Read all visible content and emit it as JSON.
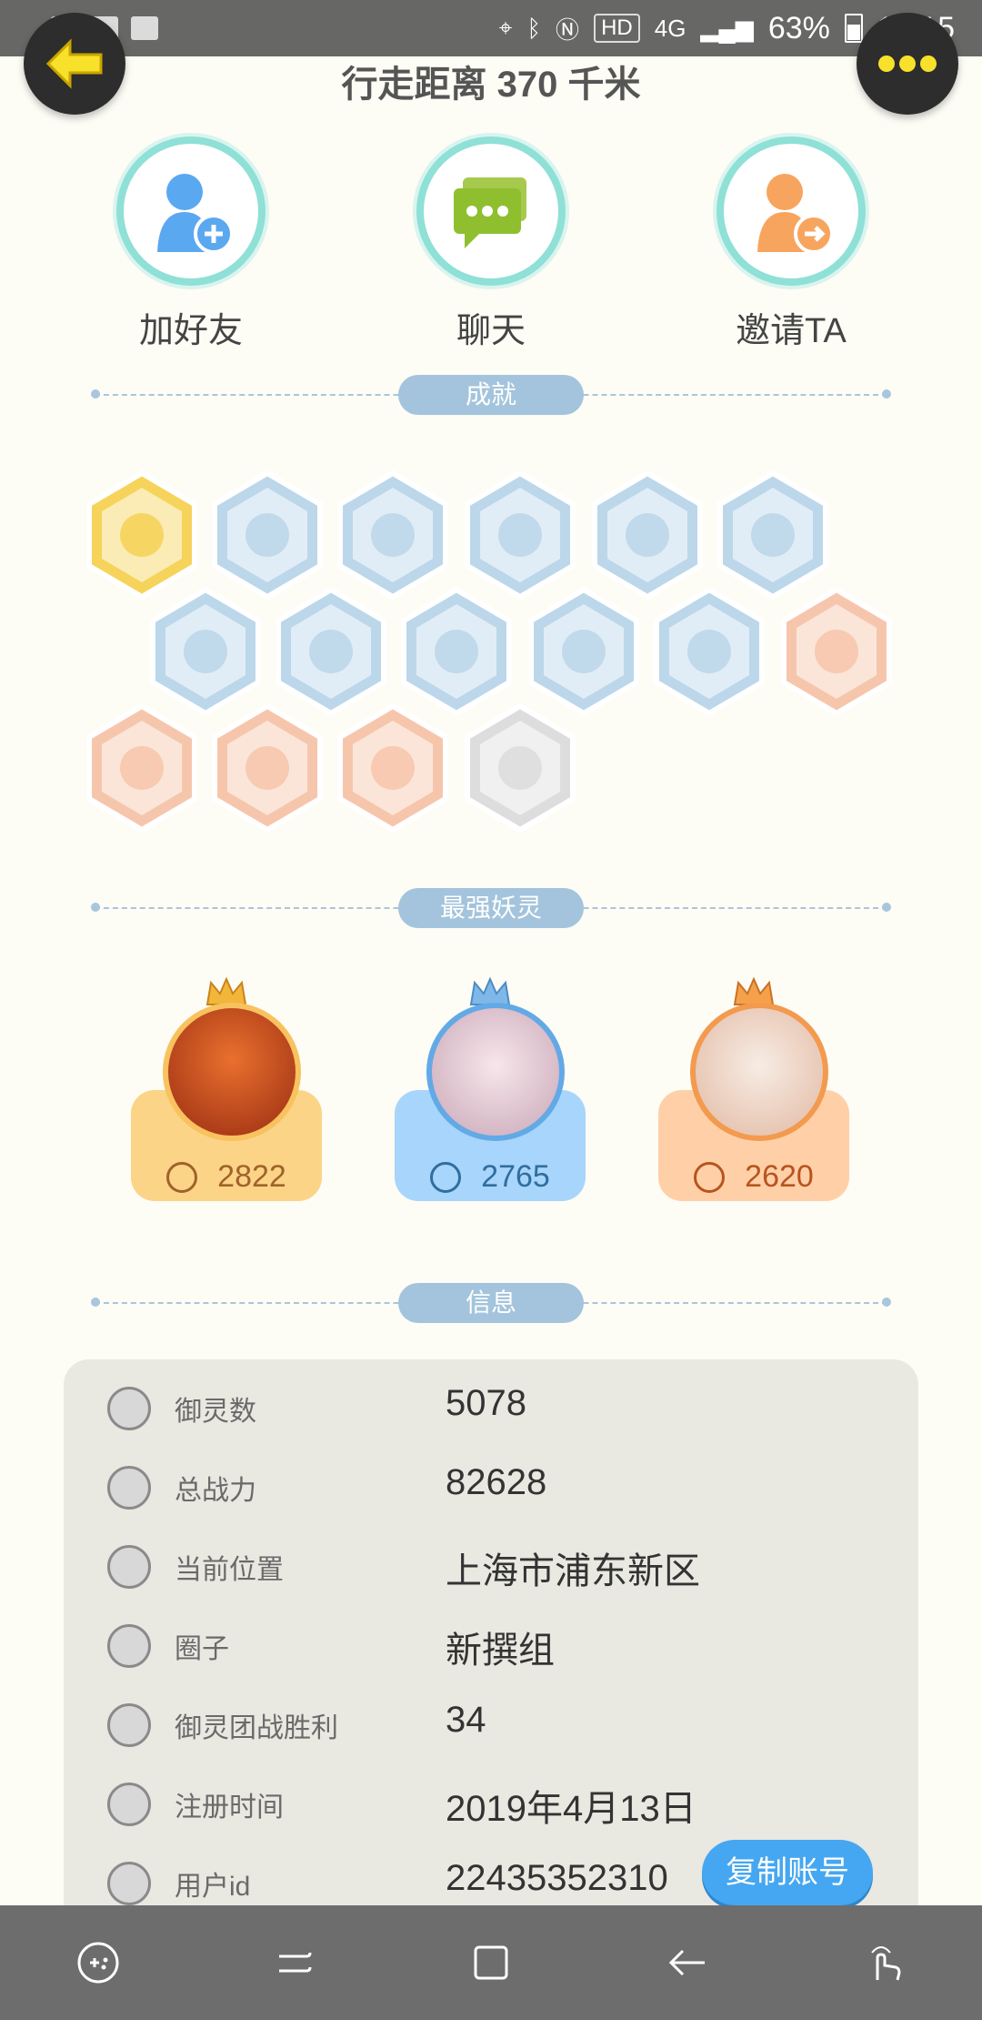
{
  "status_bar": {
    "network": "4G",
    "hd": "HD",
    "battery": "63%",
    "time": "13:15"
  },
  "header": {
    "title": "行走距离 370 千米"
  },
  "actions": [
    {
      "label": "加好友"
    },
    {
      "label": "聊天"
    },
    {
      "label": "邀请TA"
    }
  ],
  "sections": {
    "achievements": "成就",
    "strongest": "最强妖灵",
    "info": "信息"
  },
  "spirits": [
    {
      "power": "2822",
      "color": "#fbd488",
      "text_color": "#a0622a"
    },
    {
      "power": "2765",
      "color": "#a8d5fb",
      "text_color": "#2f6e9e"
    },
    {
      "power": "2620",
      "color": "#ffd0a8",
      "text_color": "#b8541e"
    }
  ],
  "info": {
    "rows": [
      {
        "key": "御灵数",
        "value": "5078"
      },
      {
        "key": "总战力",
        "value": "82628"
      },
      {
        "key": "当前位置",
        "value": "上海市浦东新区"
      },
      {
        "key": "圈子",
        "value": "新撰组"
      },
      {
        "key": "御灵团战胜利",
        "value": "34"
      },
      {
        "key": "注册时间",
        "value": "2019年4月13日"
      },
      {
        "key": "用户id",
        "value": "22435352310"
      }
    ],
    "copy_button": "复制账号"
  },
  "colors": {
    "accent": "#45a7f1",
    "badge_gold": "#f6d35a",
    "badge_blue": "#bcd7ea",
    "badge_peach": "#f6c6ac",
    "badge_gray": "#dddddd"
  }
}
